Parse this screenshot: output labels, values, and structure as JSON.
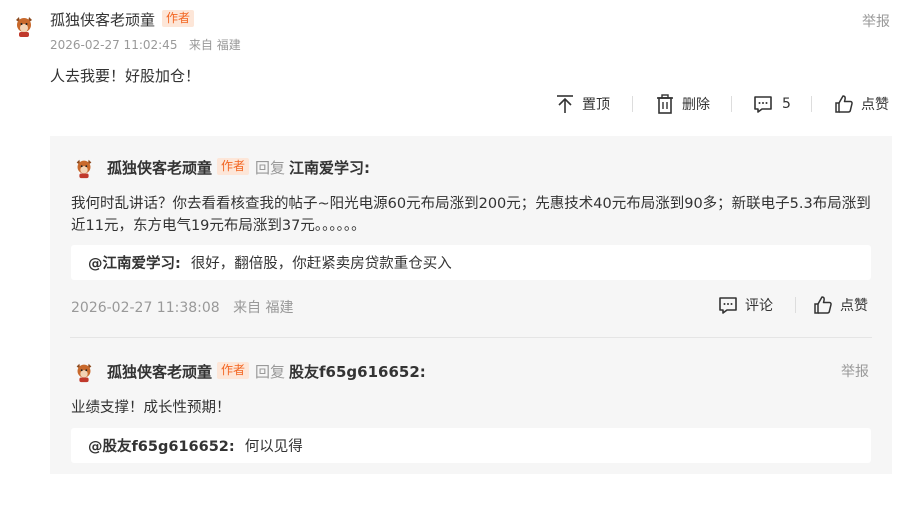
{
  "post": {
    "username": "孤独侠客老顽童",
    "author_badge": "作者",
    "report": "举报",
    "timestamp": "2026-02-27 11:02:45",
    "location": "来自 福建",
    "content": "人去我要！好股加仓！",
    "actions": {
      "pin": "置顶",
      "delete": "删除",
      "comment_count": "5",
      "like": "点赞"
    }
  },
  "replies": [
    {
      "username": "孤独侠客老顽童",
      "author_badge": "作者",
      "verb": "回复",
      "target": "江南爱学习:",
      "text": "我何时乱讲话？你去看看核查我的帖子~阳光电源60元布局涨到200元；先惠技术40元布局涨到90多；新联电子5.3布局涨到近11元，东方电气19元布局涨到37元。。。。。。",
      "quote_name": "@江南爱学习:",
      "quote_text": "很好，翻倍股，你赶紧卖房贷款重仓买入",
      "timestamp": "2026-02-27 11:38:08",
      "location": "来自 福建",
      "comment": "评论",
      "like": "点赞"
    },
    {
      "username": "孤独侠客老顽童",
      "author_badge": "作者",
      "verb": "回复",
      "target": "股友f65g616652:",
      "report": "举报",
      "text": "业绩支撑！成长性预期！",
      "quote_name": "@股友f65g616652:",
      "quote_text": "何以见得"
    }
  ],
  "colors": {
    "badge_text": "#f26522",
    "badge_bg": "#fde6d8",
    "muted": "#999999",
    "reply_bg": "#f6f6f6"
  }
}
